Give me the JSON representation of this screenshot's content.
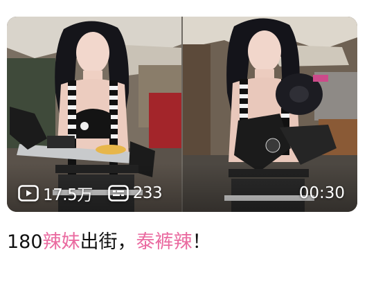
{
  "video": {
    "views": "17.5万",
    "comments": "233",
    "duration": "00:30",
    "icons": {
      "views": "play-icon",
      "comments": "danmaku-icon"
    }
  },
  "title": {
    "parts": [
      {
        "text": "180",
        "highlight": false
      },
      {
        "text": "辣妹",
        "highlight": true
      },
      {
        "text": "出街，",
        "highlight": false
      },
      {
        "text": "泰裤辣",
        "highlight": true
      },
      {
        "text": "！",
        "highlight": false
      }
    ]
  },
  "colors": {
    "highlight": "#ea6aa0",
    "text": "#111111",
    "overlay_text": "#ffffff"
  }
}
